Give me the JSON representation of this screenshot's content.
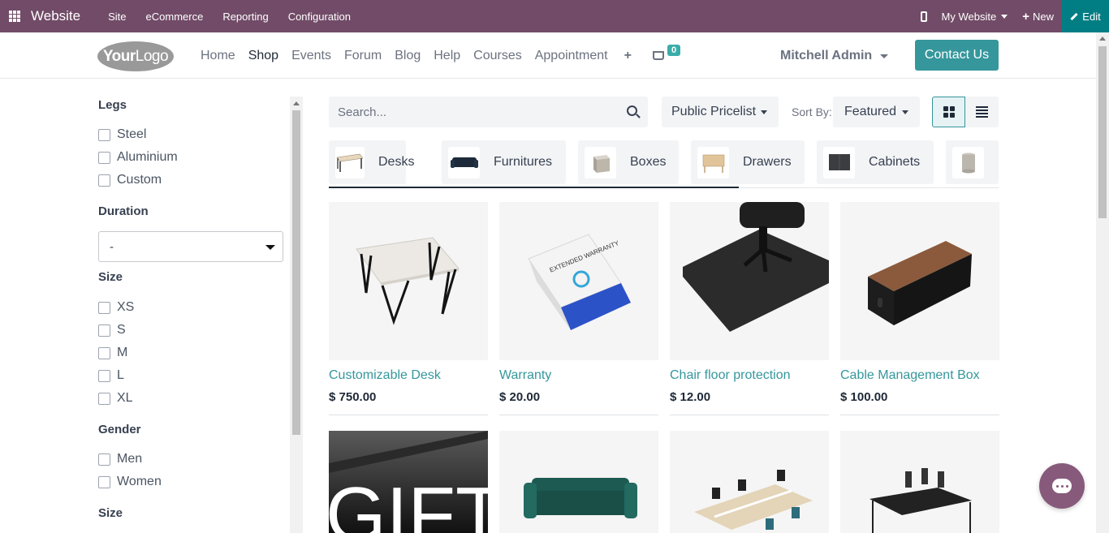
{
  "topbar": {
    "brand": "Website",
    "menus": [
      "Site",
      "eCommerce",
      "Reporting",
      "Configuration"
    ],
    "site_selector": "My Website",
    "new_label": "New",
    "edit_label": "Edit"
  },
  "header": {
    "logo_part1": "Your",
    "logo_part2": "Logo",
    "nav": [
      "Home",
      "Shop",
      "Events",
      "Forum",
      "Blog",
      "Help",
      "Courses",
      "Appointment"
    ],
    "active_nav": "Shop",
    "cart_count": "0",
    "user": "Mitchell Admin",
    "contact_label": "Contact Us"
  },
  "filters": {
    "legs": {
      "title": "Legs",
      "options": [
        "Steel",
        "Aluminium",
        "Custom"
      ]
    },
    "duration": {
      "title": "Duration",
      "selected": "-"
    },
    "size": {
      "title": "Size",
      "options": [
        "XS",
        "S",
        "M",
        "L",
        "XL"
      ]
    },
    "gender": {
      "title": "Gender",
      "options": [
        "Men",
        "Women"
      ]
    },
    "size2": {
      "title": "Size"
    }
  },
  "toolbar": {
    "search_placeholder": "Search...",
    "pricelist": "Public Pricelist",
    "sort_label": "Sort By:",
    "sort_value": "Featured"
  },
  "categories": [
    "Desks",
    "Furnitures",
    "Boxes",
    "Drawers",
    "Cabinets"
  ],
  "products": [
    {
      "name": "Customizable Desk",
      "price": "$ 750.00"
    },
    {
      "name": "Warranty",
      "price": "$ 20.00"
    },
    {
      "name": "Chair floor protection",
      "price": "$ 12.00"
    },
    {
      "name": "Cable Management Box",
      "price": "$ 100.00"
    }
  ],
  "gift_card_text": "GIFT",
  "warranty_box_text": "EXTENDED WARRANTY",
  "colors": {
    "topbar": "#714B67",
    "accent": "#35979c",
    "edit": "#017E84",
    "chat": "#875A7B"
  }
}
